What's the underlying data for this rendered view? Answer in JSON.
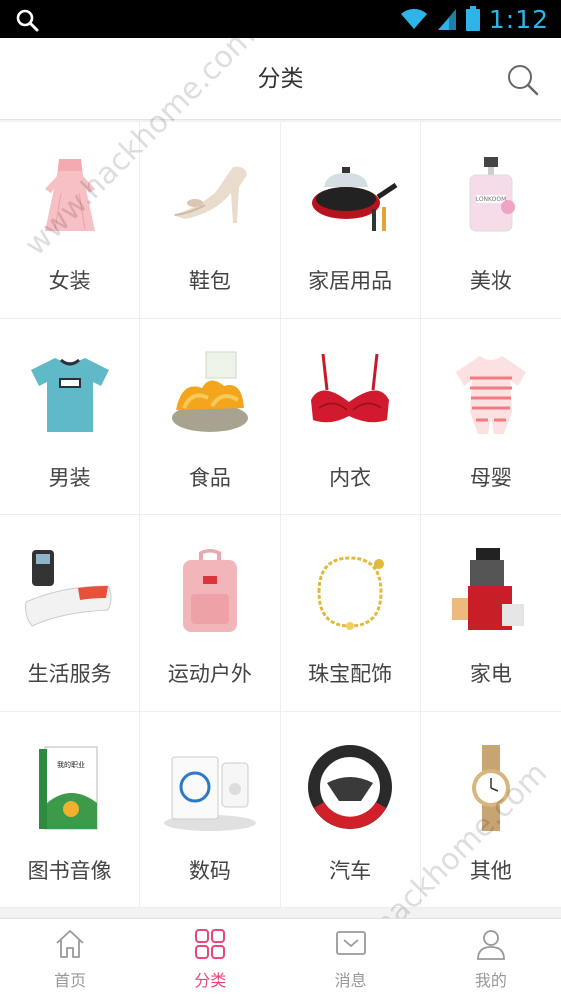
{
  "status_bar": {
    "time": "1:12"
  },
  "header": {
    "title": "分类"
  },
  "categories": [
    {
      "label": "女装",
      "icon": "dress-image"
    },
    {
      "label": "鞋包",
      "icon": "high-heel-shoe-image"
    },
    {
      "label": "家居用品",
      "icon": "cookware-pan-image"
    },
    {
      "label": "美妆",
      "icon": "perfume-bottle-image"
    },
    {
      "label": "男装",
      "icon": "tshirt-image"
    },
    {
      "label": "食品",
      "icon": "dried-mango-snack-image"
    },
    {
      "label": "内衣",
      "icon": "bra-image"
    },
    {
      "label": "母婴",
      "icon": "baby-romper-image"
    },
    {
      "label": "生活服务",
      "icon": "neck-massager-image"
    },
    {
      "label": "运动户外",
      "icon": "backpack-image"
    },
    {
      "label": "珠宝配饰",
      "icon": "gold-bracelet-image"
    },
    {
      "label": "家电",
      "icon": "juicer-image"
    },
    {
      "label": "图书音像",
      "icon": "book-image"
    },
    {
      "label": "数码",
      "icon": "doorbell-device-image"
    },
    {
      "label": "汽车",
      "icon": "steering-wheel-cover-image"
    },
    {
      "label": "其他",
      "icon": "wristwatch-image"
    }
  ],
  "tabs": [
    {
      "label": "首页",
      "icon": "home-icon",
      "active": false
    },
    {
      "label": "分类",
      "icon": "grid-icon",
      "active": true
    },
    {
      "label": "消息",
      "icon": "message-icon",
      "active": false
    },
    {
      "label": "我的",
      "icon": "user-icon",
      "active": false
    }
  ],
  "watermark": "www.hackhome.com",
  "colors": {
    "accent": "#e8477e",
    "status_icon": "#2fb4e9"
  }
}
